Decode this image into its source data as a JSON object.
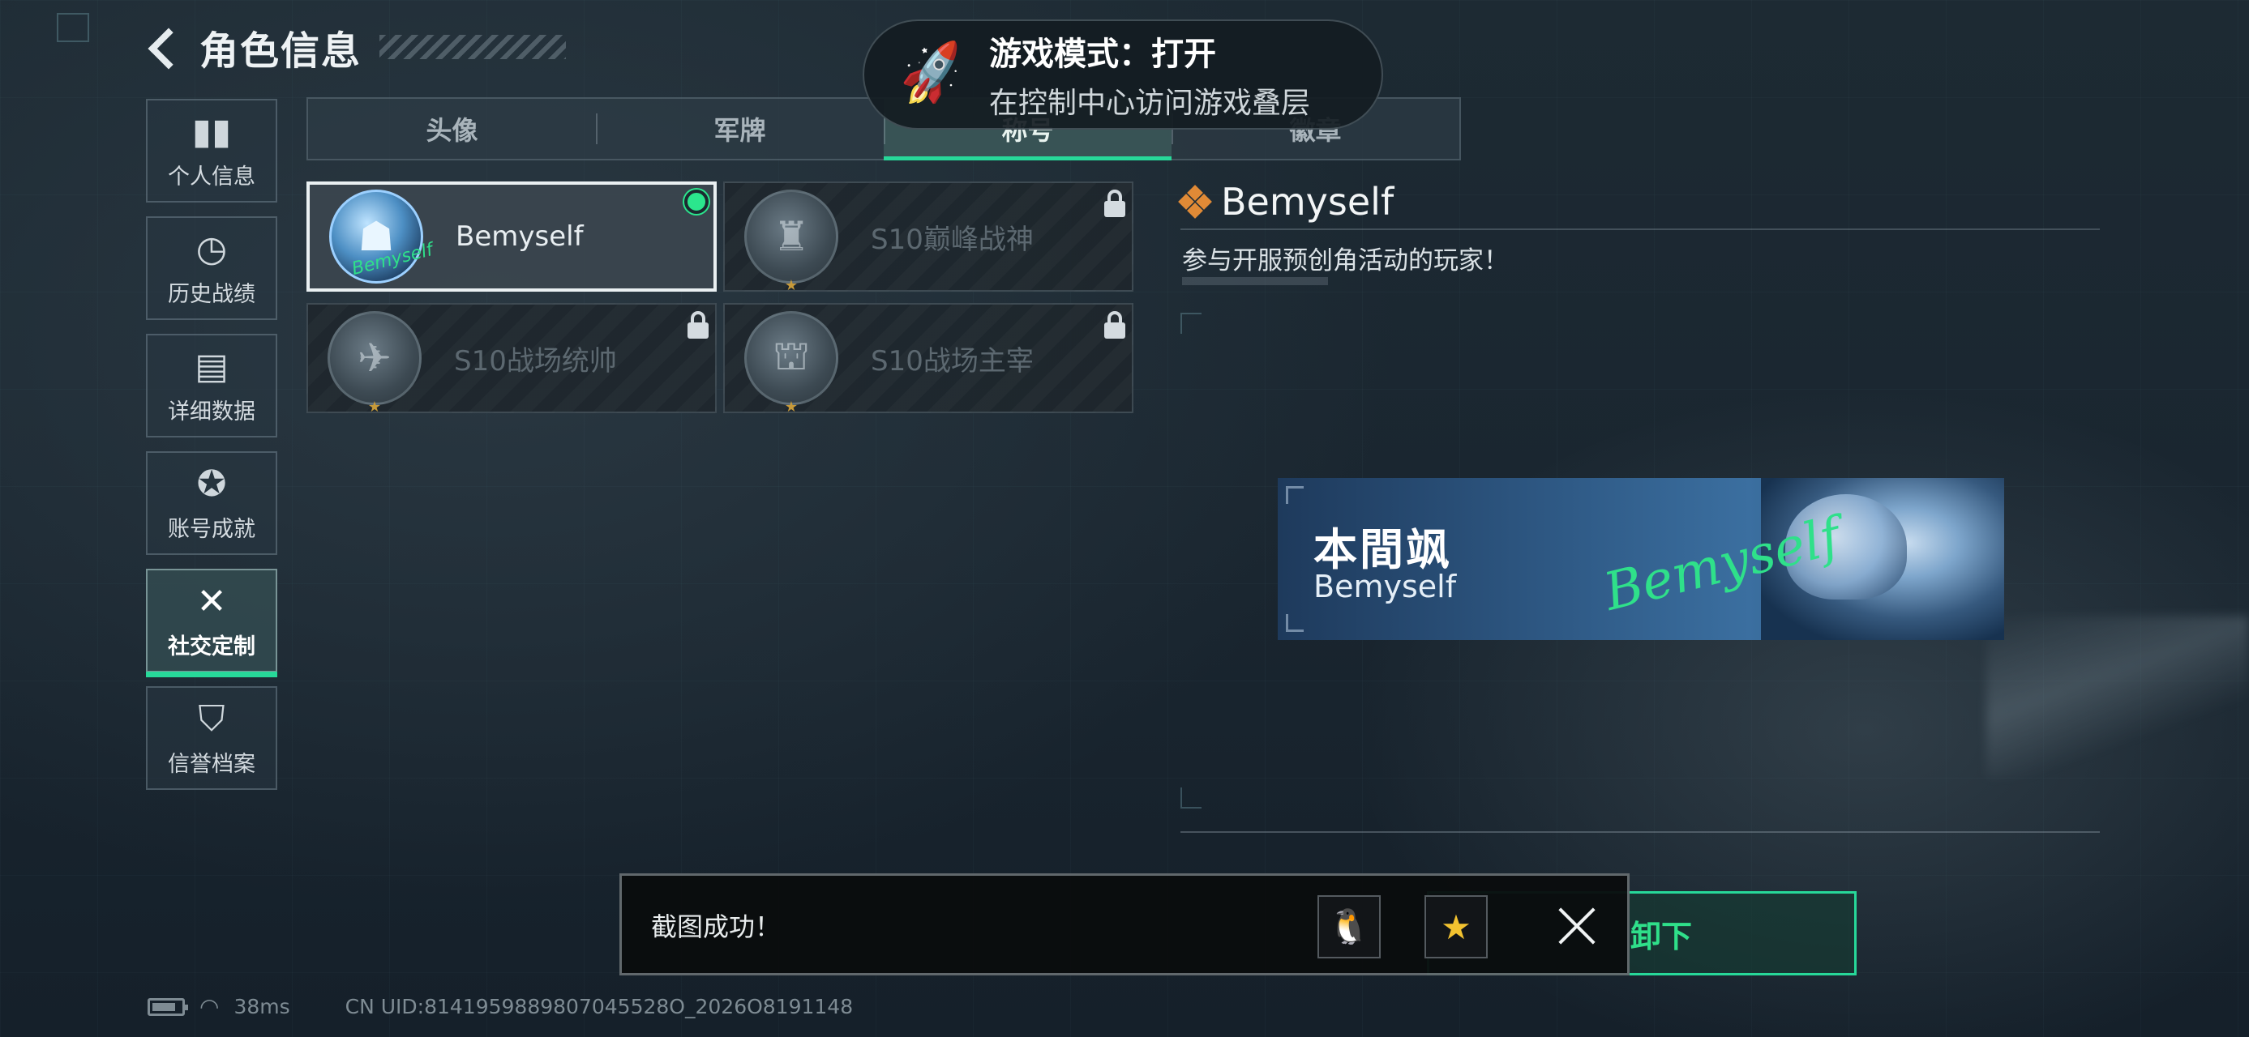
{
  "header": {
    "title": "角色信息"
  },
  "sidebar": {
    "items": [
      {
        "label": "个人信息",
        "icon": "bar-chart-icon",
        "glyph": "▮▮"
      },
      {
        "label": "历史战绩",
        "icon": "clock-icon",
        "glyph": "◷"
      },
      {
        "label": "详细数据",
        "icon": "folder-icon",
        "glyph": "▤"
      },
      {
        "label": "账号成就",
        "icon": "medal-icon",
        "glyph": "✪"
      },
      {
        "label": "社交定制",
        "icon": "tools-icon",
        "glyph": "✕"
      },
      {
        "label": "信誉档案",
        "icon": "shield-icon",
        "glyph": "⛉"
      }
    ],
    "active_index": 4
  },
  "tabs": [
    {
      "label": "头像"
    },
    {
      "label": "军牌"
    },
    {
      "label": "称号"
    },
    {
      "label": "徽章"
    }
  ],
  "cards": [
    {
      "name": "Bemyself",
      "selected": true,
      "locked": false,
      "icon": "operator-emblem-icon"
    },
    {
      "name": "S10巅峰战神",
      "selected": false,
      "locked": true,
      "icon": "tower-emblem-icon"
    },
    {
      "name": "S10战场统帅",
      "selected": false,
      "locked": true,
      "icon": "drone-emblem-icon"
    },
    {
      "name": "S10战场主宰",
      "selected": false,
      "locked": true,
      "icon": "colosseum-emblem-icon"
    }
  ],
  "detail": {
    "name": "Bemyself",
    "description": "参与开服预创角活动的玩家！"
  },
  "banner": {
    "chinese_name": "本間飒",
    "english_name": "Bemyself",
    "signature": "Bemyself"
  },
  "game_mode": {
    "line1": "游戏模式：打开",
    "line2": "在控制中心访问游戏叠层"
  },
  "toast": {
    "message": "截图成功！"
  },
  "unequip_button": {
    "label": "卸下"
  },
  "status_bar": {
    "ping": "38ms",
    "uid": "CN UID:8141959889807045528O_2026O8191148"
  },
  "colors": {
    "accent_green": "#27d899",
    "title_diamond": "#e08a36",
    "background": "#1d2a33"
  }
}
